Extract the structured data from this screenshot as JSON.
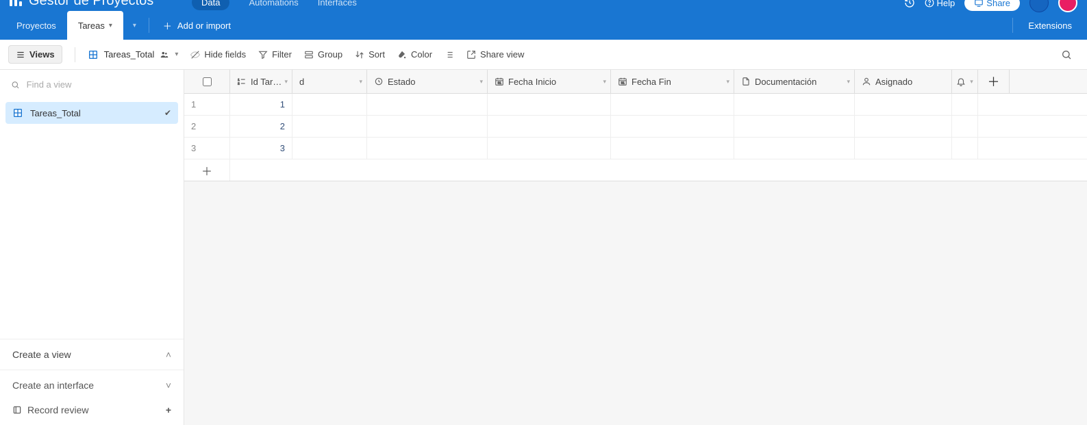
{
  "header": {
    "app_title": "Gestor de Proyectos",
    "nav": {
      "data": "Data",
      "automations": "Automations",
      "interfaces": "Interfaces"
    },
    "help": "Help",
    "share": "Share"
  },
  "tabs": {
    "items": [
      {
        "label": "Proyectos",
        "active": false
      },
      {
        "label": "Tareas",
        "active": true
      }
    ],
    "add_or_import": "Add or import",
    "extensions": "Extensions"
  },
  "toolbar": {
    "views": "Views",
    "view_name": "Tareas_Total",
    "hide_fields": "Hide fields",
    "filter": "Filter",
    "group": "Group",
    "sort": "Sort",
    "color": "Color",
    "share_view": "Share view"
  },
  "sidebar": {
    "find_placeholder": "Find a view",
    "view_item": "Tareas_Total",
    "create_view": "Create a view",
    "create_interface": "Create an interface",
    "record_review": "Record review"
  },
  "grid": {
    "columns": {
      "id": "Id Tar…",
      "d": "d",
      "estado": "Estado",
      "fecha_inicio": "Fecha Inicio",
      "fecha_fin": "Fecha Fin",
      "documentacion": "Documentación",
      "asignado": "Asignado"
    },
    "rows": [
      {
        "n": "1",
        "id": "1"
      },
      {
        "n": "2",
        "id": "2"
      },
      {
        "n": "3",
        "id": "3"
      }
    ]
  }
}
